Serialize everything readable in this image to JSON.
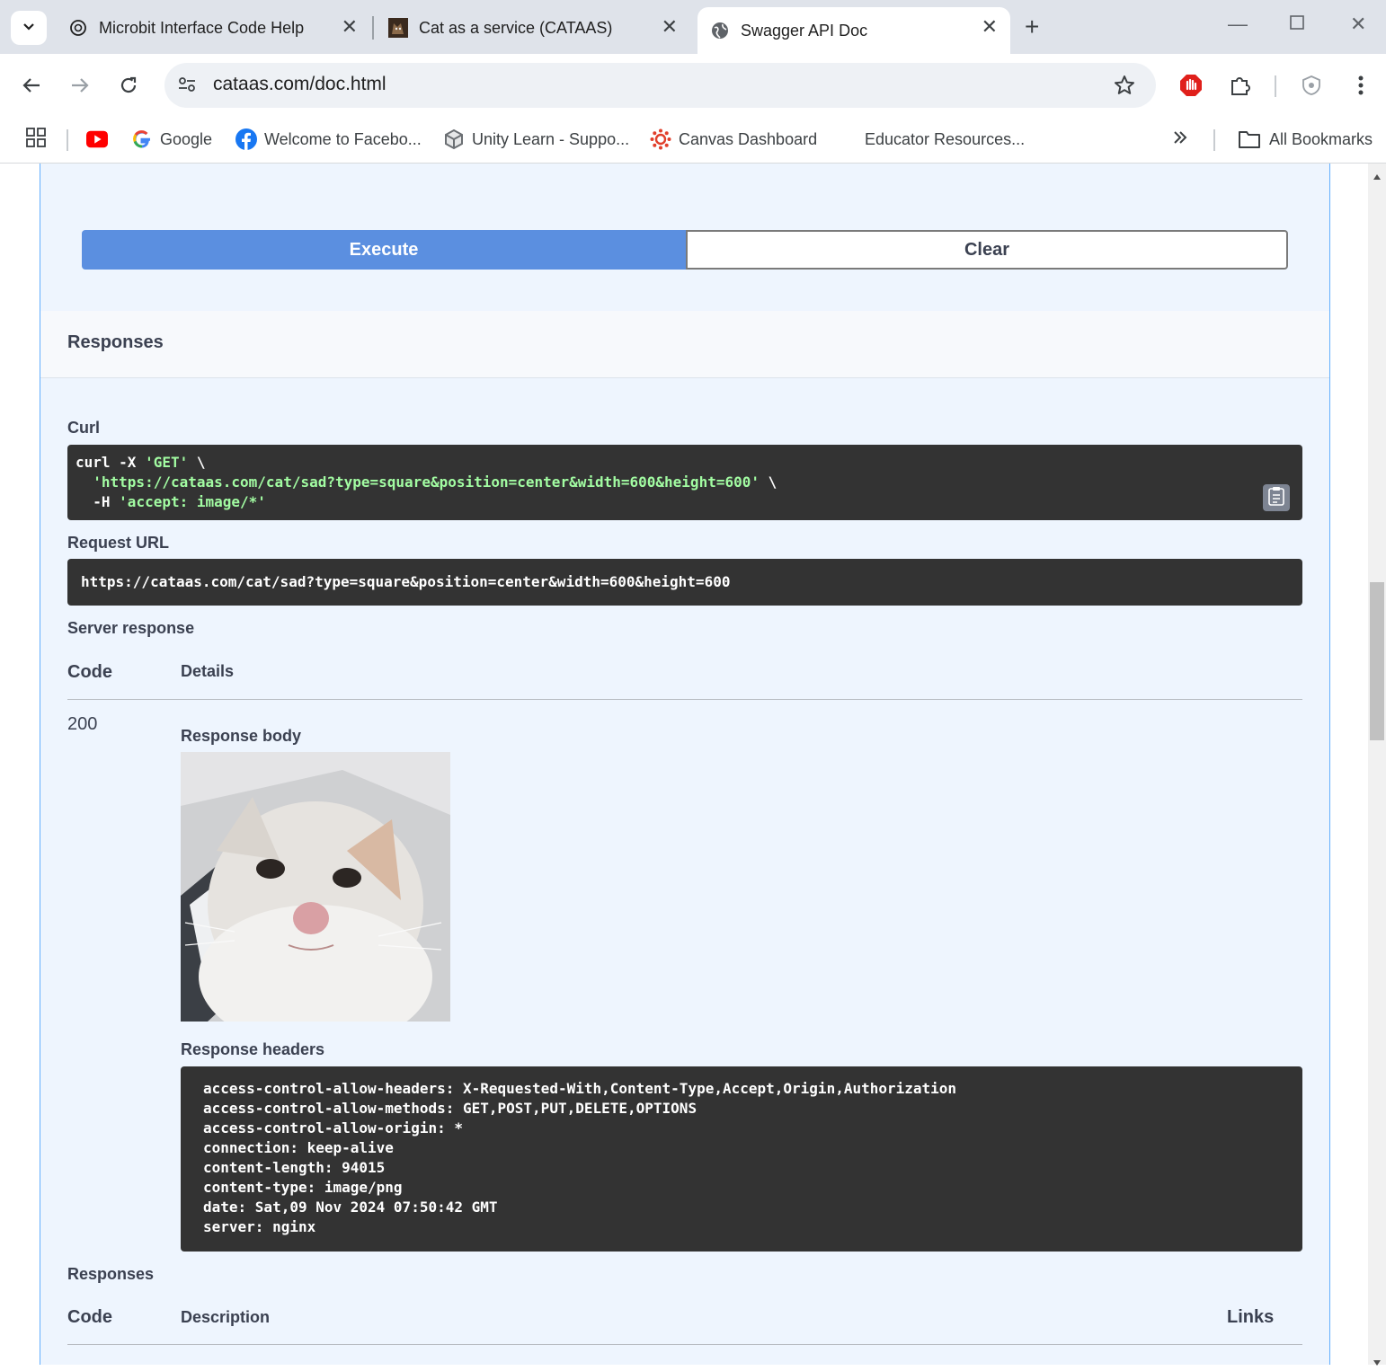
{
  "tabs": [
    {
      "title": "Microbit Interface Code Help",
      "icon": "openai-icon"
    },
    {
      "title": "Cat as a service (CATAAS)",
      "icon": "cat-favicon"
    },
    {
      "title": "Swagger API Doc",
      "icon": "globe-icon",
      "active": true
    }
  ],
  "address_bar": {
    "url": "cataas.com/doc.html"
  },
  "bookmarks": [
    {
      "label": "",
      "icon": "youtube-icon"
    },
    {
      "label": "Google",
      "icon": "google-icon"
    },
    {
      "label": "Welcome to Facebo...",
      "icon": "facebook-icon"
    },
    {
      "label": "Unity Learn - Suppo...",
      "icon": "unity-icon"
    },
    {
      "label": "Canvas Dashboard",
      "icon": "canvas-icon"
    },
    {
      "label": "Educator Resources...",
      "icon": ""
    },
    {
      "label": "All Bookmarks",
      "icon": "folder-icon"
    }
  ],
  "actions": {
    "execute": "Execute",
    "clear": "Clear"
  },
  "responses_title": "Responses",
  "curl": {
    "label": "Curl",
    "line1_cmd": "curl -X ",
    "line1_str": "'GET'",
    "line1_tail": " \\",
    "line2_str": "'https://cataas.com/cat/sad?type=square&position=center&width=600&height=600'",
    "line2_tail": " \\",
    "line3_cmd": "-H ",
    "line3_str": "'accept: image/*'"
  },
  "request_url": {
    "label": "Request URL",
    "value": "https://cataas.com/cat/sad?type=square&position=center&width=600&height=600"
  },
  "server_response": {
    "label": "Server response",
    "col_code": "Code",
    "col_details": "Details",
    "code": "200",
    "body_label": "Response body",
    "headers_label": "Response headers",
    "headers": [
      "access-control-allow-headers: X-Requested-With,Content-Type,Accept,Origin,Authorization",
      "access-control-allow-methods: GET,POST,PUT,DELETE,OPTIONS",
      "access-control-allow-origin: *",
      "connection: keep-alive",
      "content-length: 94015",
      "content-type: image/png",
      "date: Sat,09 Nov 2024 07:50:42 GMT",
      "server: nginx"
    ]
  },
  "responses_table": {
    "label": "Responses",
    "col_code": "Code",
    "col_description": "Description",
    "col_links": "Links"
  }
}
